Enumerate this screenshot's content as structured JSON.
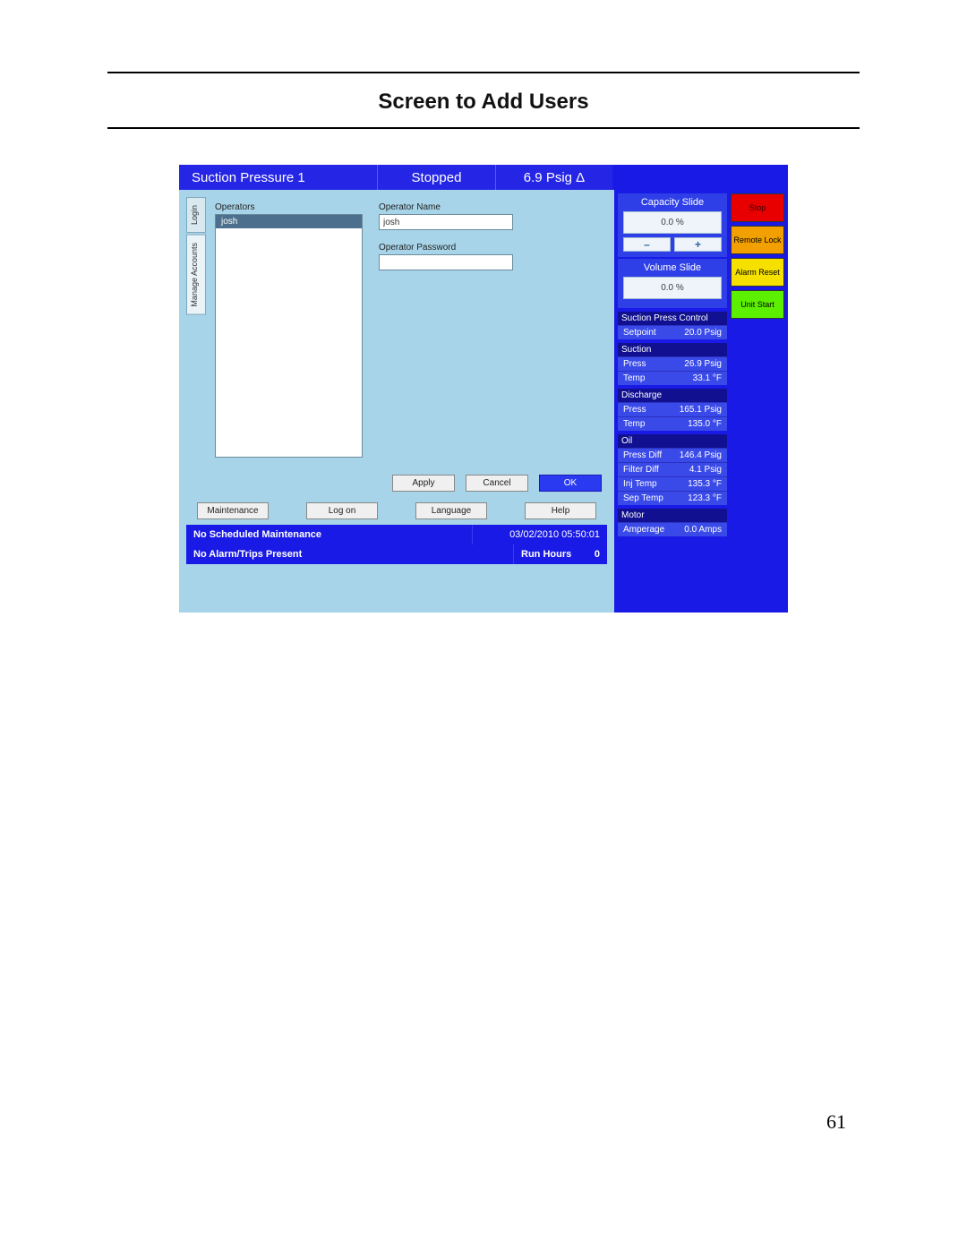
{
  "doc": {
    "title": "Screen to Add Users",
    "page_number": "61"
  },
  "header": {
    "left": "Suction Pressure 1",
    "mid": "Stopped",
    "right": "6.9 Psig Δ"
  },
  "tabs": {
    "login": "Login",
    "manage": "Manage Accounts"
  },
  "operators": {
    "list_label": "Operators",
    "items": [
      "josh"
    ],
    "name_label": "Operator Name",
    "name_value": "josh",
    "password_label": "Operator Password",
    "password_value": ""
  },
  "dialog_buttons": {
    "apply": "Apply",
    "cancel": "Cancel",
    "ok": "OK"
  },
  "nav": {
    "maintenance": "Maintenance",
    "logon": "Log on",
    "language": "Language",
    "help": "Help"
  },
  "status": {
    "maint": "No Scheduled Maintenance",
    "datetime": "03/02/2010  05:50:01",
    "alarm": "No Alarm/Trips Present",
    "runhours_label": "Run Hours",
    "runhours_value": "0"
  },
  "slides": {
    "capacity_title": "Capacity Slide",
    "capacity_value": "0.0 %",
    "volume_title": "Volume Slide",
    "volume_value": "0.0 %",
    "minus": "–",
    "plus": "+"
  },
  "ctrl": {
    "stop": "Stop",
    "remote": "Remote Lock",
    "alarm": "Alarm Reset",
    "start": "Unit Start"
  },
  "sections": {
    "spc_title": "Suction Press Control",
    "spc_rows": [
      [
        "Setpoint",
        "20.0 Psig"
      ]
    ],
    "suction_title": "Suction",
    "suction_rows": [
      [
        "Press",
        "26.9 Psig"
      ],
      [
        "Temp",
        "33.1 °F"
      ]
    ],
    "discharge_title": "Discharge",
    "discharge_rows": [
      [
        "Press",
        "165.1 Psig"
      ],
      [
        "Temp",
        "135.0 °F"
      ]
    ],
    "oil_title": "Oil",
    "oil_rows": [
      [
        "Press Diff",
        "146.4 Psig"
      ],
      [
        "Filter Diff",
        "4.1 Psig"
      ],
      [
        "Inj Temp",
        "135.3 °F"
      ],
      [
        "Sep Temp",
        "123.3 °F"
      ]
    ],
    "motor_title": "Motor",
    "motor_rows": [
      [
        "Amperage",
        "0.0 Amps"
      ]
    ]
  }
}
